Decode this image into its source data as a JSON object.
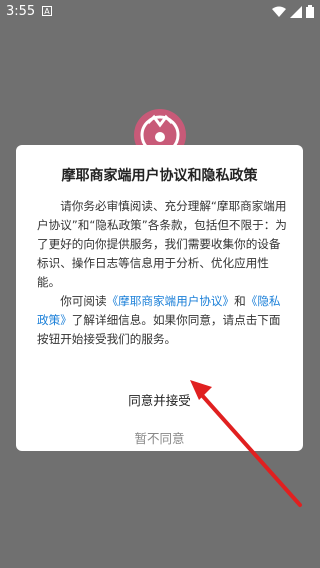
{
  "status_bar": {
    "time": "3:55",
    "a_icon": "A"
  },
  "dialog": {
    "title": "摩耶商家端用户协议和隐私政策",
    "para1": "请你务必审慎阅读、充分理解“摩耶商家端用户协议”和“隐私政策”各条款，包括但不限于：为了更好的向你提供服务，我们需要收集你的设备标识、操作日志等信息用于分析、优化应用性能。",
    "para2_prefix": "你可阅读",
    "link_user_agreement": "《摩耶商家端用户协议》",
    "para2_and": "和",
    "link_privacy_policy": "《隐私政策》",
    "para2_suffix": "了解详细信息。如果你同意，请点击下面按钮开始接受我们的服务。",
    "agree_label": "同意并接受",
    "decline_label": "暂不同意"
  },
  "colors": {
    "overlay": "#707070",
    "link": "#1a7fd8",
    "arrow": "#e02020",
    "logo": "#c85a78"
  },
  "icons": [
    "a-icon",
    "wifi-icon",
    "signal-icon",
    "battery-icon",
    "app-logo",
    "pointer-arrow"
  ]
}
